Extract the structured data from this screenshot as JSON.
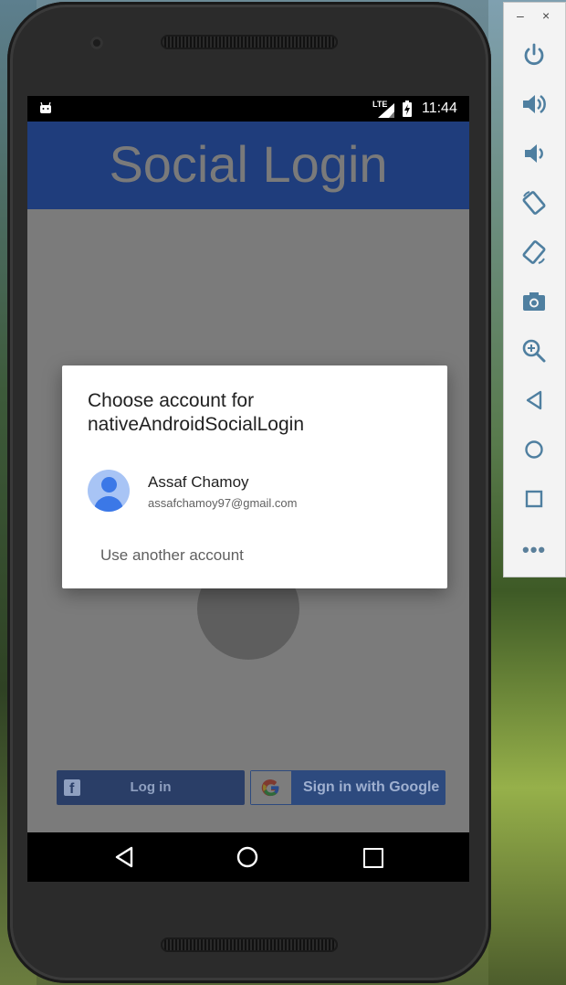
{
  "app": {
    "title": "Social Login",
    "status_time": "11:44",
    "network": "LTE"
  },
  "dialog": {
    "title": "Choose account for nativeAndroidSocialLogin",
    "account_name": "Assaf Chamoy",
    "account_email": "assafchamoy97@gmail.com",
    "another_account": "Use another account"
  },
  "buttons": {
    "facebook_label": "Log in",
    "google_label": "Sign in with Google",
    "google_letter": "G",
    "facebook_letter": "f"
  },
  "emulator": {
    "minimize": "–",
    "close": "×",
    "more": "•••",
    "icons": [
      "power-icon",
      "volume-up-icon",
      "volume-down-icon",
      "rotate-left-icon",
      "rotate-right-icon",
      "camera-icon",
      "zoom-icon",
      "back-icon",
      "home-icon",
      "overview-icon"
    ]
  },
  "colors": {
    "appbar": "#1f3d7c",
    "facebook": "#2a3e67",
    "google": "#2d4a7e",
    "emulator_icon": "#4f7fa0",
    "avatar": "#3b78e7"
  }
}
